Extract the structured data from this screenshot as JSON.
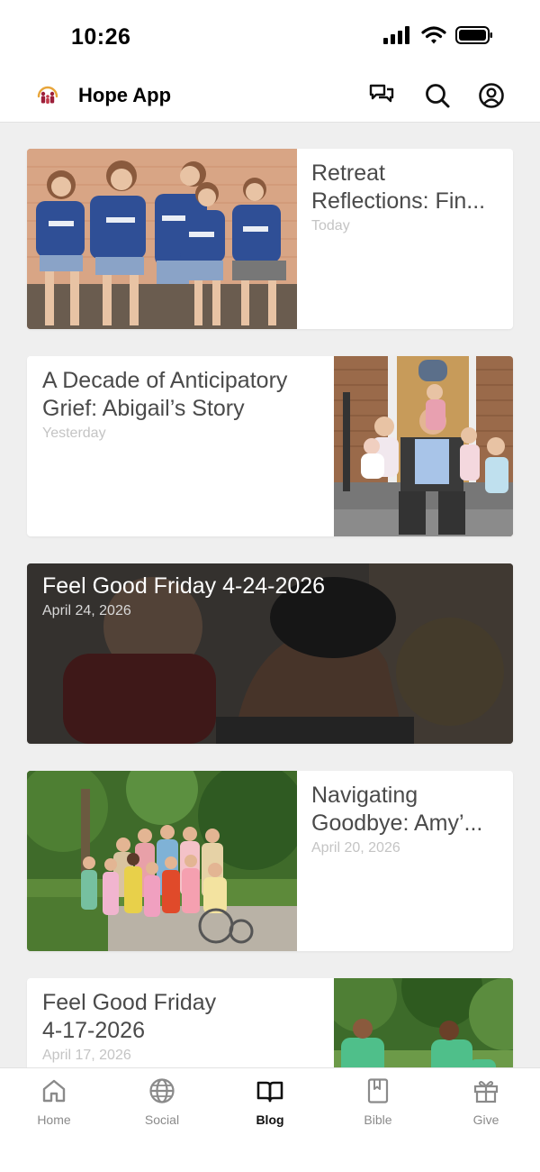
{
  "status_bar": {
    "time": "10:26"
  },
  "header": {
    "title": "Hope App"
  },
  "posts": [
    {
      "title": "Retreat Reflections: Fin...",
      "date": "Today"
    },
    {
      "title": "A Decade of Anticipatory Grief: Abigail’s Story",
      "date": "Yesterday"
    },
    {
      "title": "Feel Good Friday 4-24-2026",
      "date": "April 24, 2026"
    },
    {
      "title": "Navigating Goodbye: Amy’...",
      "date": "April 20, 2026"
    },
    {
      "title": "Feel Good Friday 4-17-2026",
      "date": "April 17, 2026"
    }
  ],
  "tabs": [
    {
      "label": "Home",
      "icon": "home-icon"
    },
    {
      "label": "Social",
      "icon": "globe-icon"
    },
    {
      "label": "Blog",
      "icon": "book-icon"
    },
    {
      "label": "Bible",
      "icon": "bible-icon"
    },
    {
      "label": "Give",
      "icon": "gift-icon"
    }
  ],
  "active_tab": "Blog",
  "colors": {
    "active_tab": "#111111",
    "inactive_tab": "#8a8a8a",
    "title_text": "#4a4a4a",
    "date_text": "#c4c4c4",
    "background": "#efefef"
  }
}
